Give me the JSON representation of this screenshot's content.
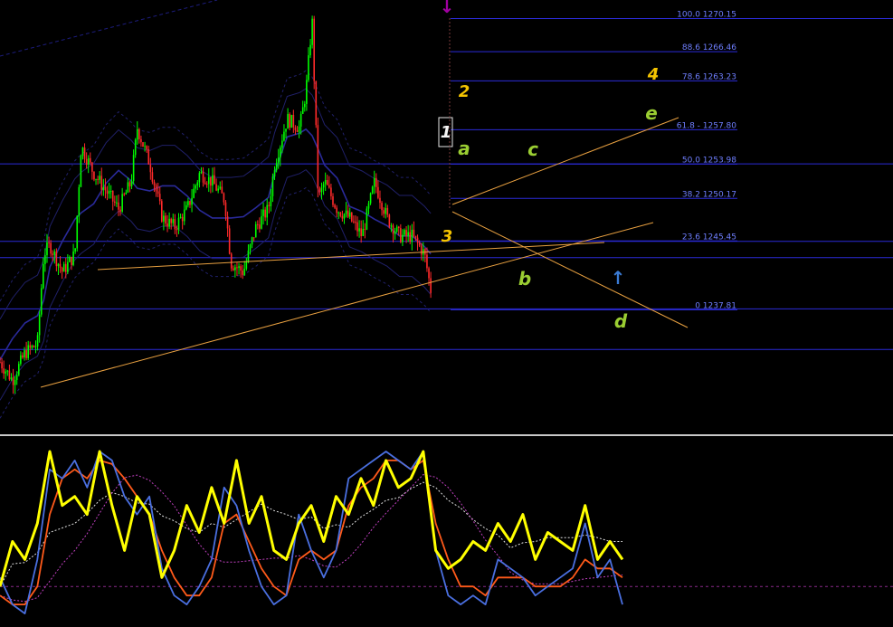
{
  "chart_data": [
    {
      "type": "candlestick",
      "title": "",
      "y_axis_range_approx": [
        1236,
        1271
      ],
      "fibonacci_levels": [
        {
          "label": "100.0 1270.15",
          "ratio": 100.0,
          "price": 1270.15
        },
        {
          "label": "88.6 1266.46",
          "ratio": 88.6,
          "price": 1266.46
        },
        {
          "label": "78.6 1263.23",
          "ratio": 78.6,
          "price": 1263.23
        },
        {
          "label": "61.8 - 1257.80",
          "ratio": 61.8,
          "price": 1257.8
        },
        {
          "label": "50.0 1253.98",
          "ratio": 50.0,
          "price": 1253.98
        },
        {
          "label": "38.2 1250.17",
          "ratio": 38.2,
          "price": 1250.17
        },
        {
          "label": "23.6 1245.45",
          "ratio": 23.6,
          "price": 1245.45
        },
        {
          "label": "0 1237.81",
          "ratio": 0.0,
          "price": 1237.81
        }
      ],
      "wave_labels": [
        {
          "text": "1",
          "color": "#f5f5f5"
        },
        {
          "text": "2",
          "color": "#f5c400"
        },
        {
          "text": "3",
          "color": "#f5c400"
        },
        {
          "text": "4",
          "color": "#f5c400"
        },
        {
          "text": "a",
          "color": "#9acd32"
        },
        {
          "text": "b",
          "color": "#9acd32"
        },
        {
          "text": "c",
          "color": "#9acd32"
        },
        {
          "text": "d",
          "color": "#9acd32"
        },
        {
          "text": "e",
          "color": "#9acd32"
        }
      ],
      "markers": [
        {
          "name": "top-arrow",
          "symbol": "↓",
          "color": "#a000a0"
        },
        {
          "name": "bottom-arrow",
          "symbol": "↑",
          "color": "#3a7bd5"
        }
      ],
      "colors": {
        "background": "#000000",
        "bull_candle": "#00ff00",
        "bear_candle": "#ff2a2a",
        "fib_line": "#2b2bd8",
        "fib_label": "#6f7fff",
        "trendline": "#e8a040",
        "bollinger": "#20206a",
        "moving_average": "#2a2a9a"
      },
      "price_path": [
        [
          0,
          1232
        ],
        [
          0.02,
          1230
        ],
        [
          0.04,
          1233
        ],
        [
          0.06,
          1234
        ],
        [
          0.07,
          1244
        ],
        [
          0.08,
          1245
        ],
        [
          0.1,
          1242
        ],
        [
          0.12,
          1244
        ],
        [
          0.13,
          1256
        ],
        [
          0.15,
          1253
        ],
        [
          0.17,
          1251
        ],
        [
          0.19,
          1249
        ],
        [
          0.21,
          1252
        ],
        [
          0.22,
          1258
        ],
        [
          0.24,
          1254
        ],
        [
          0.26,
          1248
        ],
        [
          0.28,
          1247
        ],
        [
          0.3,
          1249
        ],
        [
          0.32,
          1253
        ],
        [
          0.34,
          1252
        ],
        [
          0.36,
          1250
        ],
        [
          0.37,
          1243
        ],
        [
          0.39,
          1242
        ],
        [
          0.41,
          1247
        ],
        [
          0.43,
          1249
        ],
        [
          0.44,
          1254
        ],
        [
          0.46,
          1259
        ],
        [
          0.48,
          1258
        ],
        [
          0.49,
          1262
        ],
        [
          0.5,
          1270
        ],
        [
          0.51,
          1250
        ],
        [
          0.52,
          1252
        ],
        [
          0.54,
          1249
        ],
        [
          0.56,
          1248
        ],
        [
          0.58,
          1246
        ],
        [
          0.6,
          1252
        ],
        [
          0.62,
          1248
        ],
        [
          0.64,
          1246
        ],
        [
          0.66,
          1246
        ],
        [
          0.68,
          1244
        ],
        [
          0.69,
          1240
        ]
      ]
    },
    {
      "type": "line",
      "title": "",
      "ylim": [
        0,
        100
      ],
      "series": [
        {
          "color": "#ffff00",
          "values": [
            20,
            45,
            35,
            55,
            95,
            65,
            70,
            60,
            95,
            65,
            40,
            70,
            60,
            25,
            40,
            65,
            50,
            75,
            55,
            90,
            55,
            70,
            40,
            35,
            55,
            65,
            45,
            70,
            60,
            80,
            65,
            90,
            75,
            80,
            95,
            40,
            30,
            35,
            45,
            40,
            55,
            45,
            60,
            35,
            50,
            45,
            40,
            65,
            35,
            45,
            35
          ]
        },
        {
          "color": "#4a6fe0",
          "values": [
            25,
            10,
            5,
            35,
            85,
            80,
            90,
            75,
            95,
            90,
            70,
            60,
            70,
            30,
            15,
            10,
            20,
            35,
            75,
            65,
            40,
            20,
            10,
            15,
            60,
            40,
            25,
            40,
            80,
            85,
            90,
            95,
            90,
            85,
            95,
            40,
            15,
            10,
            15,
            10,
            35,
            30,
            25,
            15,
            20,
            25,
            30,
            55,
            25,
            35,
            10
          ]
        },
        {
          "color": "#ff5a1a",
          "values": [
            15,
            10,
            10,
            20,
            60,
            80,
            85,
            80,
            90,
            88,
            80,
            70,
            60,
            40,
            25,
            15,
            15,
            25,
            55,
            60,
            45,
            30,
            20,
            15,
            35,
            40,
            35,
            40,
            65,
            75,
            80,
            90,
            90,
            85,
            90,
            55,
            35,
            20,
            20,
            15,
            25,
            25,
            25,
            20,
            20,
            20,
            25,
            35,
            30,
            30,
            25
          ]
        }
      ],
      "reference_level": 20
    }
  ]
}
